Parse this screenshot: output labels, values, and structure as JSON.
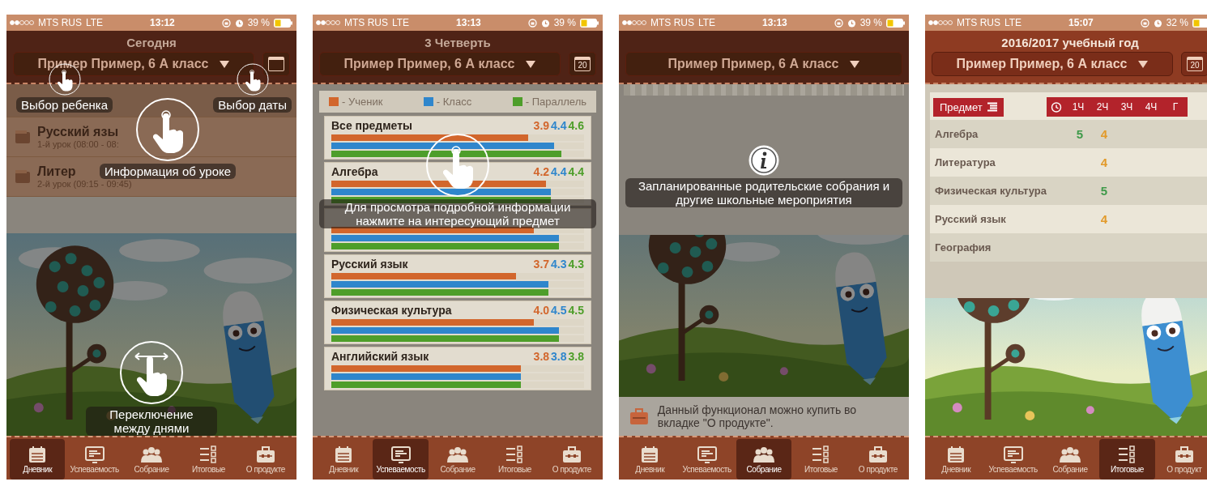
{
  "screens": [
    {
      "kind": "diary",
      "dimmed": true,
      "status_bar": {
        "carrier": "MTS RUS",
        "network": "LTE",
        "time": "13:12",
        "battery": "39 %"
      },
      "header": {
        "title": "Сегодня",
        "student": "Пример Пример, 6 А класс",
        "calendar_button": true
      },
      "lessons": [
        {
          "subject": "Русский язы",
          "time": "1-й урок (08:00 - 08:"
        },
        {
          "subject": "Литер",
          "time": "2-й урок (09:15 - 09:45)"
        }
      ],
      "hints": [
        {
          "kind": "tap",
          "text": "Выбор ребенка"
        },
        {
          "kind": "tap",
          "text": "Выбор даты"
        },
        {
          "kind": "tap",
          "text": "Информация об уроке"
        },
        {
          "kind": "swipe",
          "text": "Переключение между днями"
        }
      ],
      "tabs": [
        {
          "kind": "diary",
          "label": "Дневник",
          "selected": true
        },
        {
          "kind": "grades",
          "label": "Успеваемость",
          "selected": false
        },
        {
          "kind": "meeting",
          "label": "Собрание",
          "selected": false
        },
        {
          "kind": "results",
          "label": "Итоговые",
          "selected": false
        },
        {
          "kind": "product",
          "label": "О продукте",
          "selected": false
        }
      ]
    },
    {
      "kind": "progress",
      "dimmed": true,
      "status_bar": {
        "carrier": "MTS RUS",
        "network": "LTE",
        "time": "13:13",
        "battery": "39 %"
      },
      "header": {
        "title": "3 Четверть",
        "student": "Пример Пример, 6 А класс",
        "calendar_button": true,
        "calendar_day": "20"
      },
      "legend": [
        {
          "label": "- Ученик",
          "color": "#d2662c"
        },
        {
          "label": "- Класс",
          "color": "#2f86cc"
        },
        {
          "label": "- Параллель",
          "color": "#4e9e2a"
        }
      ],
      "subjects": [
        {
          "name": "Все предметы",
          "values": [
            "3.9",
            "4.4",
            "4.6"
          ],
          "bars": [
            {
              "level": 0.78
            },
            {
              "level": 0.88
            },
            {
              "level": 0.91
            }
          ]
        },
        {
          "name": "Алгебра",
          "values": [
            "4.2",
            "4.4",
            "4.4"
          ],
          "bars": [
            {
              "level": 0.85
            },
            {
              "level": 0.87
            },
            {
              "level": 0.87
            }
          ]
        },
        {
          "bars": [
            {
              "level": 0.8
            },
            {
              "level": 0.9
            },
            {
              "level": 0.9
            }
          ]
        },
        {
          "name": "Русский язык",
          "values": [
            "3.7",
            "4.3",
            "4.3"
          ],
          "bars": [
            {
              "level": 0.73
            },
            {
              "level": 0.86
            },
            {
              "level": 0.86
            }
          ]
        },
        {
          "name": "Физическая культура",
          "values": [
            "4.0",
            "4.5",
            "4.5"
          ],
          "bars": [
            {
              "level": 0.8
            },
            {
              "level": 0.9
            },
            {
              "level": 0.9
            }
          ]
        },
        {
          "name": "Английский язык",
          "values": [
            "3.8",
            "3.8",
            "3.8"
          ],
          "bars": [
            {
              "level": 0.75
            },
            {
              "level": 0.75
            },
            {
              "level": 0.75
            }
          ]
        }
      ],
      "hints": [
        {
          "kind": "tap",
          "text": "Для просмотра подробной информации нажмите на интересующий предмет"
        }
      ],
      "tabs": [
        {
          "kind": "diary",
          "label": "Дневник",
          "selected": false
        },
        {
          "kind": "grades",
          "label": "Успеваемость",
          "selected": true
        },
        {
          "kind": "meeting",
          "label": "Собрание",
          "selected": false
        },
        {
          "kind": "results",
          "label": "Итоговые",
          "selected": false
        },
        {
          "kind": "product",
          "label": "О продукте",
          "selected": false
        }
      ]
    },
    {
      "kind": "meeting",
      "dimmed": true,
      "status_bar": {
        "carrier": "MTS RUS",
        "network": "LTE",
        "time": "13:13",
        "battery": "39 %"
      },
      "header": {
        "student": "Пример Пример, 6 А класс",
        "calendar_button": false
      },
      "hints": [
        {
          "kind": "info",
          "text": "Запланированные родительские собрания и другие школьные мероприятия"
        }
      ],
      "notice": "Данный функционал можно купить во вкладке \"О продукте\".",
      "tabs": [
        {
          "kind": "diary",
          "label": "Дневник",
          "selected": false
        },
        {
          "kind": "grades",
          "label": "Успеваемость",
          "selected": false
        },
        {
          "kind": "meeting",
          "label": "Собрание",
          "selected": true
        },
        {
          "kind": "results",
          "label": "Итоговые",
          "selected": false
        },
        {
          "kind": "product",
          "label": "О продукте",
          "selected": false
        }
      ]
    },
    {
      "kind": "results",
      "dimmed": false,
      "status_bar": {
        "carrier": "MTS RUS",
        "network": "LTE",
        "time": "15:07",
        "battery": "32 %"
      },
      "header": {
        "title": "2016/2017 учебный год",
        "student": "Пример Пример, 6 А класс",
        "calendar_button": true,
        "calendar_day": "20"
      },
      "table": {
        "subject_header": "Предмет",
        "columns": [
          "1Ч",
          "2Ч",
          "3Ч",
          "4Ч",
          "Г"
        ],
        "rows": [
          {
            "subject": "Алгебра",
            "q1": {
              "text": "5",
              "color": "#3f9a4a"
            },
            "q2": {
              "text": "4",
              "color": "#e29a2a"
            }
          },
          {
            "subject": "Литература",
            "q2": {
              "text": "4",
              "color": "#e29a2a"
            }
          },
          {
            "subject": "Физическая культура",
            "q2": {
              "text": "5",
              "color": "#3f9a4a"
            }
          },
          {
            "subject": "Русский язык",
            "q2": {
              "text": "4",
              "color": "#e29a2a"
            }
          },
          {
            "subject": "География"
          }
        ]
      },
      "tabs": [
        {
          "kind": "diary",
          "label": "Дневник",
          "selected": false
        },
        {
          "kind": "grades",
          "label": "Успеваемость",
          "selected": false
        },
        {
          "kind": "meeting",
          "label": "Собрание",
          "selected": false
        },
        {
          "kind": "results",
          "label": "Итоговые",
          "selected": true
        },
        {
          "kind": "product",
          "label": "О продукт",
          "selected": false
        }
      ]
    }
  ]
}
